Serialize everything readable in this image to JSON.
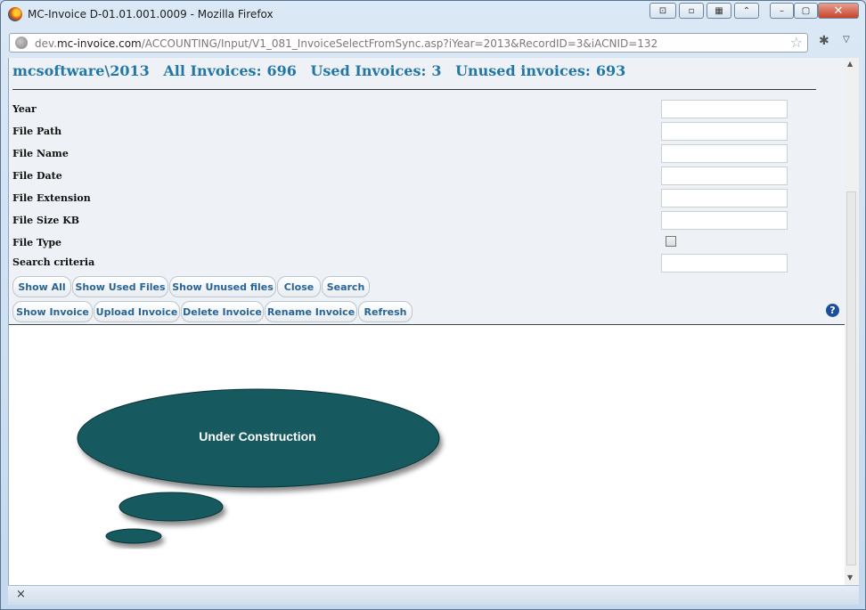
{
  "window": {
    "title": "MC-Invoice D-01.01.001.0009 - Mozilla Firefox"
  },
  "urlbar": {
    "prefix": "dev.",
    "domain": "mc-invoice.com",
    "path": "/ACCOUNTING/Input/V1_081_InvoiceSelectFromSync.asp?iYear=2013&RecordID=3&iACNID=132"
  },
  "header": {
    "company_year": "mcsoftware\\2013",
    "all_label": "All Invoices:",
    "all_count": "696",
    "used_label": "Used Invoices:",
    "used_count": "3",
    "unused_label": "Unused invoices:",
    "unused_count": "693"
  },
  "form": {
    "year_label": "Year",
    "file_path_label": "File Path",
    "file_name_label": "File Name",
    "file_date_label": "File Date",
    "file_extension_label": "File Extension",
    "file_size_label": "File Size KB",
    "file_type_label": "File Type",
    "search_criteria_label": "Search criteria"
  },
  "buttons": {
    "show_all": "Show All",
    "show_used": "Show Used Files",
    "show_unused": "Show Unused files",
    "close": "Close",
    "search": "Search",
    "show_invoice": "Show Invoice",
    "upload_invoice": "Upload Invoice",
    "delete_invoice": "Delete Invoice",
    "rename_invoice": "Rename Invoice",
    "refresh": "Refresh"
  },
  "bubble": {
    "text": "Under Construction",
    "color": "#135a60"
  },
  "statusbar": {
    "close_glyph": "×"
  }
}
